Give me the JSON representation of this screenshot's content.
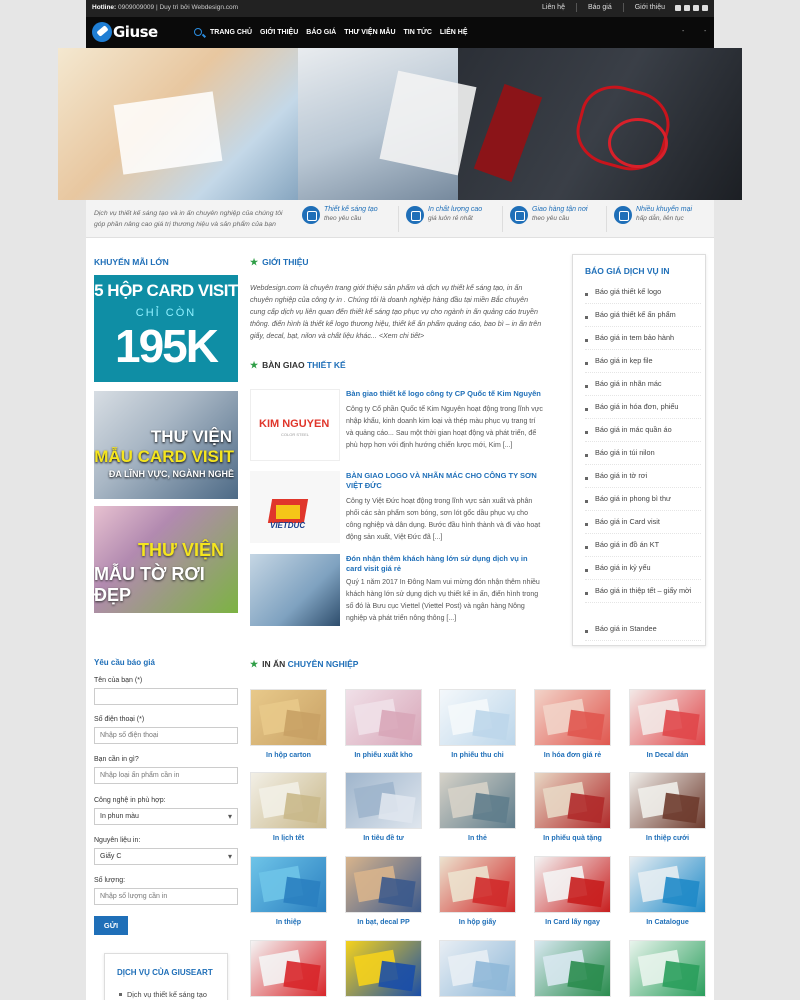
{
  "topbar": {
    "hotline_label": "Hotline:",
    "hotline_text": "0909009009 | Duy trì bởi Webdesign.com",
    "links": [
      "Liên hệ",
      "Báo giá",
      "Giới thiệu"
    ]
  },
  "header": {
    "logo_text": "Giuse",
    "menu": [
      "TRANG CHỦ",
      "GIỚI THIỆU",
      "BÁO GIÁ",
      "THƯ VIỆN MẪU",
      "TIN TỨC",
      "LIÊN HỆ"
    ],
    "extra": [
      "-",
      "-"
    ]
  },
  "tagline": "Dịch vụ thiết kế sáng tạo và in ấn chuyên nghiệp của chúng tôi góp phần nâng cao giá trị thương hiệu và sản phẩm của bạn",
  "features": [
    {
      "title": "Thiết kế sáng tạo",
      "sub": "theo yêu cầu",
      "icon": "pen-icon"
    },
    {
      "title": "In chất lượng cao",
      "sub": "giá luôn rẻ nhất",
      "icon": "print-icon"
    },
    {
      "title": "Giao hàng tận nơi",
      "sub": "theo yêu cầu",
      "icon": "truck-icon"
    },
    {
      "title": "Nhiều khuyến mại",
      "sub": "hấp dẫn, liên tục",
      "icon": "gift-icon"
    }
  ],
  "promo": {
    "title": "KHUYẾN MÃI LỚN",
    "banner1": {
      "line1": "5 HỘP CARD VISIT",
      "line2": "CHỈ CÒN",
      "line3": "195K"
    },
    "banner2": {
      "line1": "THƯ VIỆN",
      "line2": "MẪU CARD VISIT",
      "line3": "ĐA LĨNH VỰC, NGÀNH NGHỀ"
    },
    "banner3": {
      "line1": "THƯ VIỆN",
      "line2": "MẪU TỜ RƠI ĐẸP"
    }
  },
  "intro": {
    "title": "GIỚI THIỆU",
    "text": "Webdesign.com là chuyên trang giới thiệu sản phẩm và dịch vụ thiết kế sáng tạo, in ấn chuyên nghiệp của công ty in . Chúng tôi là doanh nghiệp hàng đầu tại miền Bắc chuyên cung cấp dịch vụ liên quan đến thiết kế sáng tạo phục vụ cho ngành in ấn quảng cáo truyền thông. điển hình là thiết kế logo thương hiệu, thiết kế ấn phẩm quảng cáo, bao bì – in ấn trên giấy, decal, bạt, nilon và chất liệu khác... <Xem chi tiết>"
  },
  "ban_giao": {
    "title_dark": "BÀN GIAO",
    "title_blue": "THIẾT KẾ",
    "posts": [
      {
        "title": "Bàn giao thiết kế logo công ty CP Quốc tế Kim Nguyên",
        "excerpt": "Công ty Cổ phần Quốc tế Kim Nguyên hoạt động trong lĩnh vực nhập khẩu, kinh doanh kim loại và thép màu phục vụ trang trí và quảng cáo... Sau một thời gian hoạt động và phát triển, để phù hợp hơn với định hướng chiến lược mới, Kim [...]",
        "thumb_text": "KIM NGUYEN",
        "thumb_sub": "COLOR STEEL"
      },
      {
        "title": "BÀN GIAO LOGO VÀ NHÃN MÁC CHO CÔNG TY SƠN VIỆT ĐỨC",
        "excerpt": "Công ty Việt Đức hoạt động trong lĩnh vực sản xuất và phân phối các sản phẩm sơn bóng, sơn lót gốc dầu phục vụ cho công nghiệp và dân dụng. Bước đầu hình thành và đi vào hoạt động sản xuất, Việt Đức đã [...]",
        "thumb_text": "VIETDUC"
      },
      {
        "title": "Đón nhận thêm khách hàng lớn sử dụng dịch vụ in card visit giá rẻ",
        "excerpt": "Quý 1 năm 2017 In Đông Nam vui mừng đón nhận thêm nhiều khách hàng lớn sử dụng dịch vụ thiết kế in ấn, điển hình trong số đó là Bưu cục Viettel (Viettel Post) và ngân hàng Nông nghiệp và phát triển nông thông [...]"
      }
    ]
  },
  "bao_gia": {
    "title": "BÁO GIÁ DỊCH VỤ IN",
    "items": [
      "Báo giá thiết kế logo",
      "Báo giá thiết kế ấn phẩm",
      "Báo giá in tem bảo hành",
      "Báo giá in kẹp file",
      "Báo giá in nhãn mác",
      "Báo giá in hóa đơn, phiếu",
      "Báo giá in mác quần áo",
      "Báo giá in túi nilon",
      "Báo giá in tờ rơi",
      "Báo giá in phong bì thư",
      "Báo giá in Card visit",
      "Báo giá in đồ án KT",
      "Báo giá in kỷ yếu",
      "Báo giá in thiệp tết – giấy mời",
      "Báo giá in Standee"
    ]
  },
  "form": {
    "title": "Yêu cầu báo giá",
    "name_label": "Tên của bạn (*)",
    "name_value": "",
    "phone_label": "Số điện thoại (*)",
    "phone_placeholder": "Nhập số điện thoại",
    "need_label": "Bạn cần in gì?",
    "need_placeholder": "Nhập loại ấn phẩm cần in",
    "tech_label": "Công nghệ in phù hợp:",
    "tech_value": "In phun màu",
    "material_label": "Nguyên liệu in:",
    "material_value": "Giấy C",
    "qty_label": "Số lượng:",
    "qty_placeholder": "Nhập số lượng cần in",
    "submit": "GỬI"
  },
  "dich_vu": {
    "title": "DỊCH VỤ CỦA GIUSEART",
    "items": [
      "Dịch vụ thiết kế sáng tạo"
    ]
  },
  "in_an": {
    "title_dark": "IN ẤN",
    "title_blue": "CHUYÊN NGHIỆP",
    "items": [
      {
        "label": "In hộp carton",
        "c1": "#c8a165",
        "c2": "#e8c98a"
      },
      {
        "label": "In phiếu xuất kho",
        "c1": "#d8a6b8",
        "c2": "#f0e0e8"
      },
      {
        "label": "In phiếu thu chi",
        "c1": "#bcd6ea",
        "c2": "#f4f8fb"
      },
      {
        "label": "In hóa đơn giá rẻ",
        "c1": "#e0574f",
        "c2": "#f2d3c8"
      },
      {
        "label": "In Decal dán",
        "c1": "#e0474a",
        "c2": "#f3e8e6"
      },
      {
        "label": "In lịch tết",
        "c1": "#c9b88a",
        "c2": "#f2efe6"
      },
      {
        "label": "In tiêu đề tư",
        "c1": "#dfe6ee",
        "c2": "#9fb5cc"
      },
      {
        "label": "In thẻ",
        "c1": "#5f7d8c",
        "c2": "#d6d2c8"
      },
      {
        "label": "In phiếu quà tặng",
        "c1": "#b02a2a",
        "c2": "#e8d7c4"
      },
      {
        "label": "In thiệp cưới",
        "c1": "#6e3b2e",
        "c2": "#f0eeea"
      },
      {
        "label": "In thiệp",
        "c1": "#2a7fc0",
        "c2": "#6ec4e8"
      },
      {
        "label": "In bạt, decal PP",
        "c1": "#3c5a8c",
        "c2": "#d8b48c"
      },
      {
        "label": "In hộp giấy",
        "c1": "#d02a2a",
        "c2": "#ece2ce"
      },
      {
        "label": "In Card lấy ngay",
        "c1": "#c81e1e",
        "c2": "#f4f4f4"
      },
      {
        "label": "In Catalogue",
        "c1": "#1f8ac8",
        "c2": "#e6edf2"
      },
      {
        "label": "",
        "c1": "#d8262a",
        "c2": "#f4f4f4"
      },
      {
        "label": "",
        "c1": "#1a4ea8",
        "c2": "#f5d21c"
      },
      {
        "label": "",
        "c1": "#8fb8d8",
        "c2": "#e8eef4"
      },
      {
        "label": "",
        "c1": "#2a8c4e",
        "c2": "#d8e8f0"
      },
      {
        "label": "",
        "c1": "#2a9e5c",
        "c2": "#e8f4ec"
      }
    ]
  },
  "colors": {
    "accent": "#1f6fb8",
    "star": "#2e9e46",
    "topbar": "#222222",
    "navbar": "#0a0a0a"
  }
}
